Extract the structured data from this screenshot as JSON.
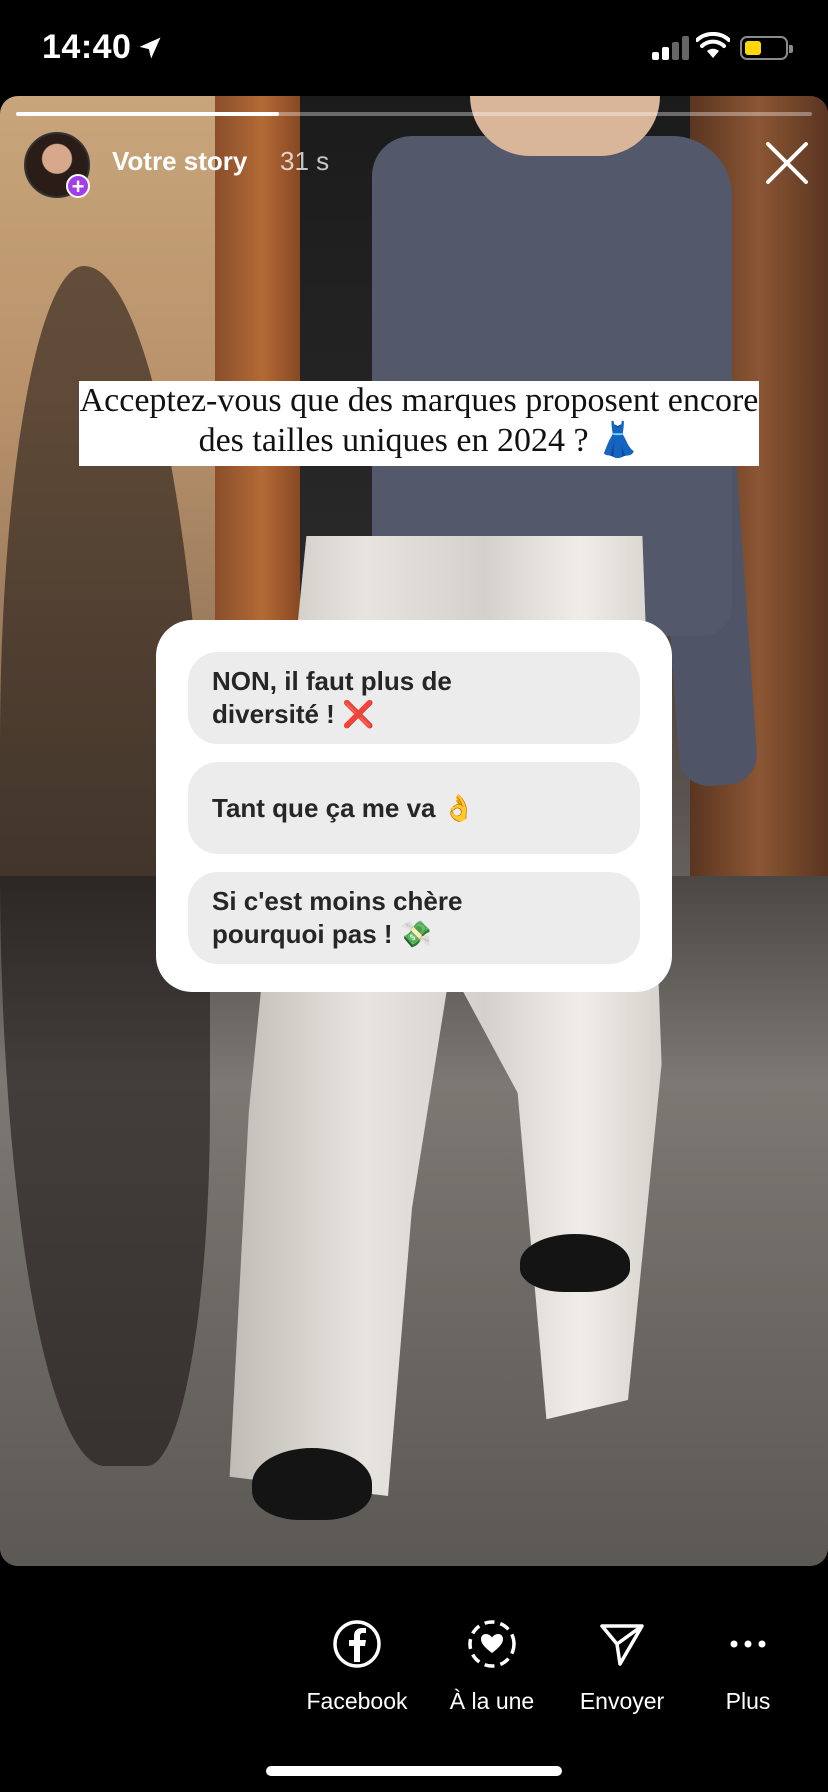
{
  "status_bar": {
    "time": "14:40"
  },
  "story": {
    "username": "Votre story",
    "elapsed": "31 s",
    "progress": 0.33,
    "question": "Acceptez-vous que des marques proposent encore des tailles uniques en 2024 ? 👗",
    "poll_options": [
      "NON, il faut plus de diversité ! ❌",
      "Tant que ça me va 👌",
      "Si c'est moins chère pourquoi pas ! 💸"
    ]
  },
  "actions": [
    {
      "label": "Facebook",
      "icon": "facebook-icon"
    },
    {
      "label": "À la une",
      "icon": "highlight-heart-icon"
    },
    {
      "label": "Envoyer",
      "icon": "send-icon"
    },
    {
      "label": "Plus",
      "icon": "more-icon"
    }
  ],
  "colors": {
    "accent_plus": "#a23ee8",
    "battery": "#ffd60a"
  }
}
